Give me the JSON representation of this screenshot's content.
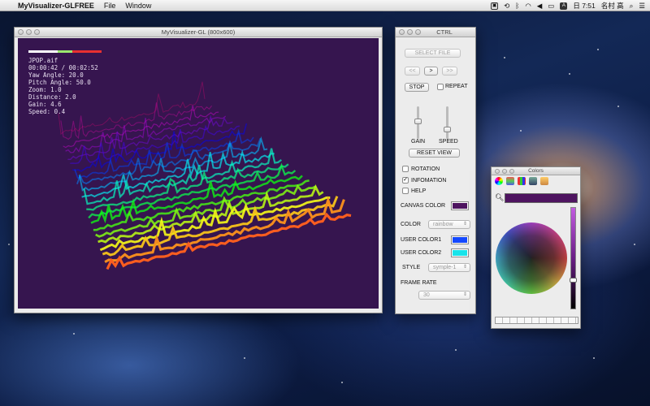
{
  "menubar": {
    "app_name": "MyVisualizer-GLFREE",
    "menus": [
      "File",
      "Window"
    ],
    "clock": "日 7:51",
    "user": "名村 高",
    "input_badge": "A"
  },
  "visualizer": {
    "title": "MyVisualizer-GL (800x600)",
    "info_lines": [
      "JPOP.aif",
      "00:00:42 / 00:02:52",
      "Yaw Angle: 20.0",
      "Pitch Angle: 50.0",
      "Zoom:  1.0",
      "Distance:  2.0",
      "Gain:  4.6",
      "Speed:  0.4"
    ],
    "canvas_color": "#36154f"
  },
  "ctrl": {
    "title": "CTRL",
    "select_file": "SELECT FILE",
    "prev": "<<",
    "play": ">",
    "next": ">>",
    "stop": "STOP",
    "repeat": "REPEAT",
    "gain_label": "GAIN",
    "speed_label": "SPEED",
    "reset_view": "RESET VIEW",
    "rotation": "ROTATION",
    "infomation": "INFOMATION",
    "help": "HELP",
    "canvas_color_label": "CANVAS COLOR",
    "canvas_color_value": "#4e1460",
    "color_label": "COLOR",
    "color_value": "rainbow",
    "user_color1_label": "USER COLOR1",
    "user_color1_value": "#1448ff",
    "user_color2_label": "USER COLOR2",
    "user_color2_value": "#18e4ea",
    "style_label": "STYLE",
    "style_value": "symple-1",
    "frame_rate_label": "FRAME RATE",
    "frame_rate_value": "30",
    "rotation_checked": false,
    "infomation_checked": true,
    "help_checked": false,
    "repeat_checked": false
  },
  "colors_panel": {
    "title": "Colors",
    "preview_color": "#4e1460"
  }
}
